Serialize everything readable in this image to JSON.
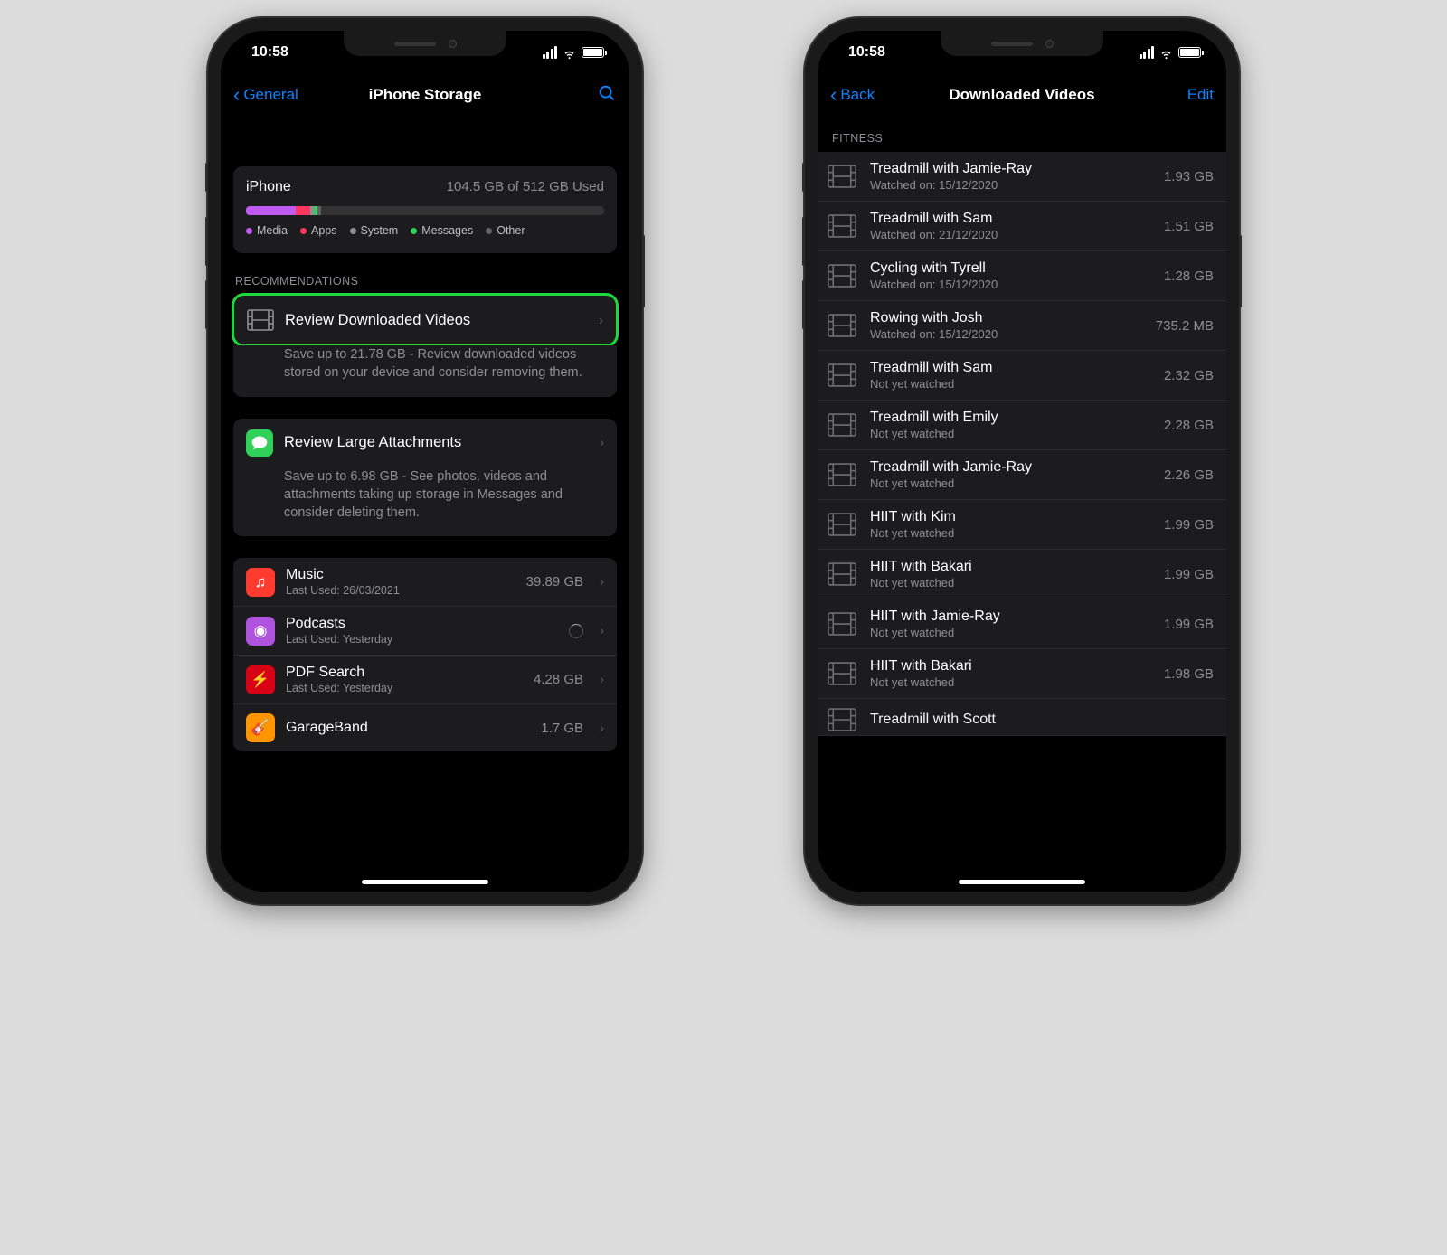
{
  "statusTime": "10:58",
  "left": {
    "back": "General",
    "title": "iPhone Storage",
    "storage": {
      "device": "iPhone",
      "used_text": "104.5 GB of 512 GB Used",
      "segments": [
        {
          "label": "Media",
          "color": "#bf5af2",
          "pct": 14
        },
        {
          "label": "Apps",
          "color": "#ff375f",
          "pct": 4
        },
        {
          "label": "System",
          "color": "#8e8e93",
          "pct": 1
        },
        {
          "label": "Messages",
          "color": "#30d158",
          "pct": 1
        },
        {
          "label": "Other",
          "color": "#636366",
          "pct": 1
        }
      ]
    },
    "recommendations_header": "RECOMMENDATIONS",
    "rec1": {
      "label": "Review Downloaded Videos",
      "desc": "Save up to 21.78 GB - Review downloaded videos stored on your device and consider removing them."
    },
    "rec2": {
      "label": "Review Large Attachments",
      "desc": "Save up to 6.98 GB - See photos, videos and attachments taking up storage in Messages and consider deleting them."
    },
    "apps": [
      {
        "name": "Music",
        "sub": "Last Used: 26/03/2021",
        "size": "39.89 GB",
        "color": "#ff3b30",
        "glyph": "♫"
      },
      {
        "name": "Podcasts",
        "sub": "Last Used: Yesterday",
        "size": "",
        "color": "#af52de",
        "glyph": "◉",
        "loading": true
      },
      {
        "name": "PDF Search",
        "sub": "Last Used: Yesterday",
        "size": "4.28 GB",
        "color": "#d70015",
        "glyph": "⚡"
      },
      {
        "name": "GarageBand",
        "sub": "",
        "size": "1.7 GB",
        "color": "#ff9500",
        "glyph": "🎸"
      }
    ]
  },
  "right": {
    "back": "Back",
    "title": "Downloaded Videos",
    "edit": "Edit",
    "section": "FITNESS",
    "videos": [
      {
        "title": "Treadmill with Jamie-Ray",
        "sub": "Watched on: 15/12/2020",
        "size": "1.93 GB"
      },
      {
        "title": "Treadmill with Sam",
        "sub": "Watched on: 21/12/2020",
        "size": "1.51 GB"
      },
      {
        "title": "Cycling with Tyrell",
        "sub": "Watched on: 15/12/2020",
        "size": "1.28 GB"
      },
      {
        "title": "Rowing with Josh",
        "sub": "Watched on: 15/12/2020",
        "size": "735.2 MB"
      },
      {
        "title": "Treadmill with Sam",
        "sub": "Not yet watched",
        "size": "2.32 GB"
      },
      {
        "title": "Treadmill with Emily",
        "sub": "Not yet watched",
        "size": "2.28 GB"
      },
      {
        "title": "Treadmill with Jamie-Ray",
        "sub": "Not yet watched",
        "size": "2.26 GB"
      },
      {
        "title": "HIIT with Kim",
        "sub": "Not yet watched",
        "size": "1.99 GB"
      },
      {
        "title": "HIIT with Bakari",
        "sub": "Not yet watched",
        "size": "1.99 GB"
      },
      {
        "title": "HIIT with Jamie-Ray",
        "sub": "Not yet watched",
        "size": "1.99 GB"
      },
      {
        "title": "HIIT with Bakari",
        "sub": "Not yet watched",
        "size": "1.98 GB"
      }
    ],
    "partial": {
      "title": "Treadmill with Scott",
      "size": ""
    }
  }
}
